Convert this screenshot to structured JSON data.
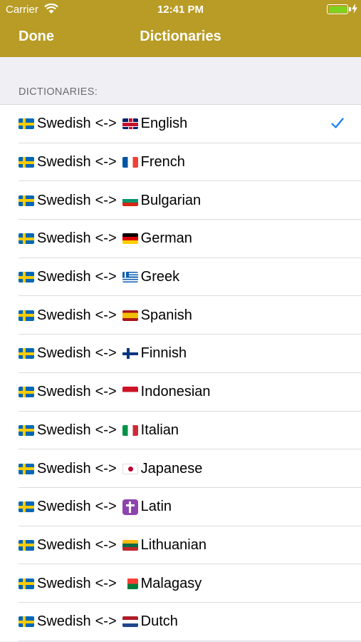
{
  "status_bar": {
    "carrier": "Carrier",
    "time": "12:41 PM",
    "battery_color": "#7ed321"
  },
  "nav": {
    "done_label": "Done",
    "title": "Dictionaries",
    "bar_color": "#b89c26"
  },
  "section": {
    "header": "DICTIONARIES:"
  },
  "dictionaries": [
    {
      "from": "Swedish",
      "separator": "<->",
      "to": "English",
      "from_flag": "sweden-flag-icon",
      "to_flag": "uk-flag-icon",
      "selected": true
    },
    {
      "from": "Swedish",
      "separator": "<->",
      "to": "French",
      "from_flag": "sweden-flag-icon",
      "to_flag": "france-flag-icon",
      "selected": false
    },
    {
      "from": "Swedish",
      "separator": "<->",
      "to": "Bulgarian",
      "from_flag": "sweden-flag-icon",
      "to_flag": "bulgaria-flag-icon",
      "selected": false
    },
    {
      "from": "Swedish",
      "separator": "<->",
      "to": "German",
      "from_flag": "sweden-flag-icon",
      "to_flag": "germany-flag-icon",
      "selected": false
    },
    {
      "from": "Swedish",
      "separator": "<->",
      "to": "Greek",
      "from_flag": "sweden-flag-icon",
      "to_flag": "greece-flag-icon",
      "selected": false
    },
    {
      "from": "Swedish",
      "separator": "<->",
      "to": "Spanish",
      "from_flag": "sweden-flag-icon",
      "to_flag": "spain-flag-icon",
      "selected": false
    },
    {
      "from": "Swedish",
      "separator": "<->",
      "to": "Finnish",
      "from_flag": "sweden-flag-icon",
      "to_flag": "finland-flag-icon",
      "selected": false
    },
    {
      "from": "Swedish",
      "separator": "<->",
      "to": "Indonesian",
      "from_flag": "sweden-flag-icon",
      "to_flag": "indonesia-flag-icon",
      "selected": false
    },
    {
      "from": "Swedish",
      "separator": "<->",
      "to": "Italian",
      "from_flag": "sweden-flag-icon",
      "to_flag": "italy-flag-icon",
      "selected": false
    },
    {
      "from": "Swedish",
      "separator": "<->",
      "to": "Japanese",
      "from_flag": "sweden-flag-icon",
      "to_flag": "japan-flag-icon",
      "selected": false
    },
    {
      "from": "Swedish",
      "separator": "<->",
      "to": "Latin",
      "from_flag": "sweden-flag-icon",
      "to_flag": "latin-cross-icon",
      "selected": false
    },
    {
      "from": "Swedish",
      "separator": "<->",
      "to": "Lithuanian",
      "from_flag": "sweden-flag-icon",
      "to_flag": "lithuania-flag-icon",
      "selected": false
    },
    {
      "from": "Swedish",
      "separator": "<->",
      "to": "Malagasy",
      "from_flag": "sweden-flag-icon",
      "to_flag": "madagascar-flag-icon",
      "selected": false
    },
    {
      "from": "Swedish",
      "separator": "<->",
      "to": "Dutch",
      "from_flag": "sweden-flag-icon",
      "to_flag": "netherlands-flag-icon",
      "selected": false
    }
  ],
  "colors": {
    "checkmark": "#157efb",
    "background": "#efeff4"
  }
}
